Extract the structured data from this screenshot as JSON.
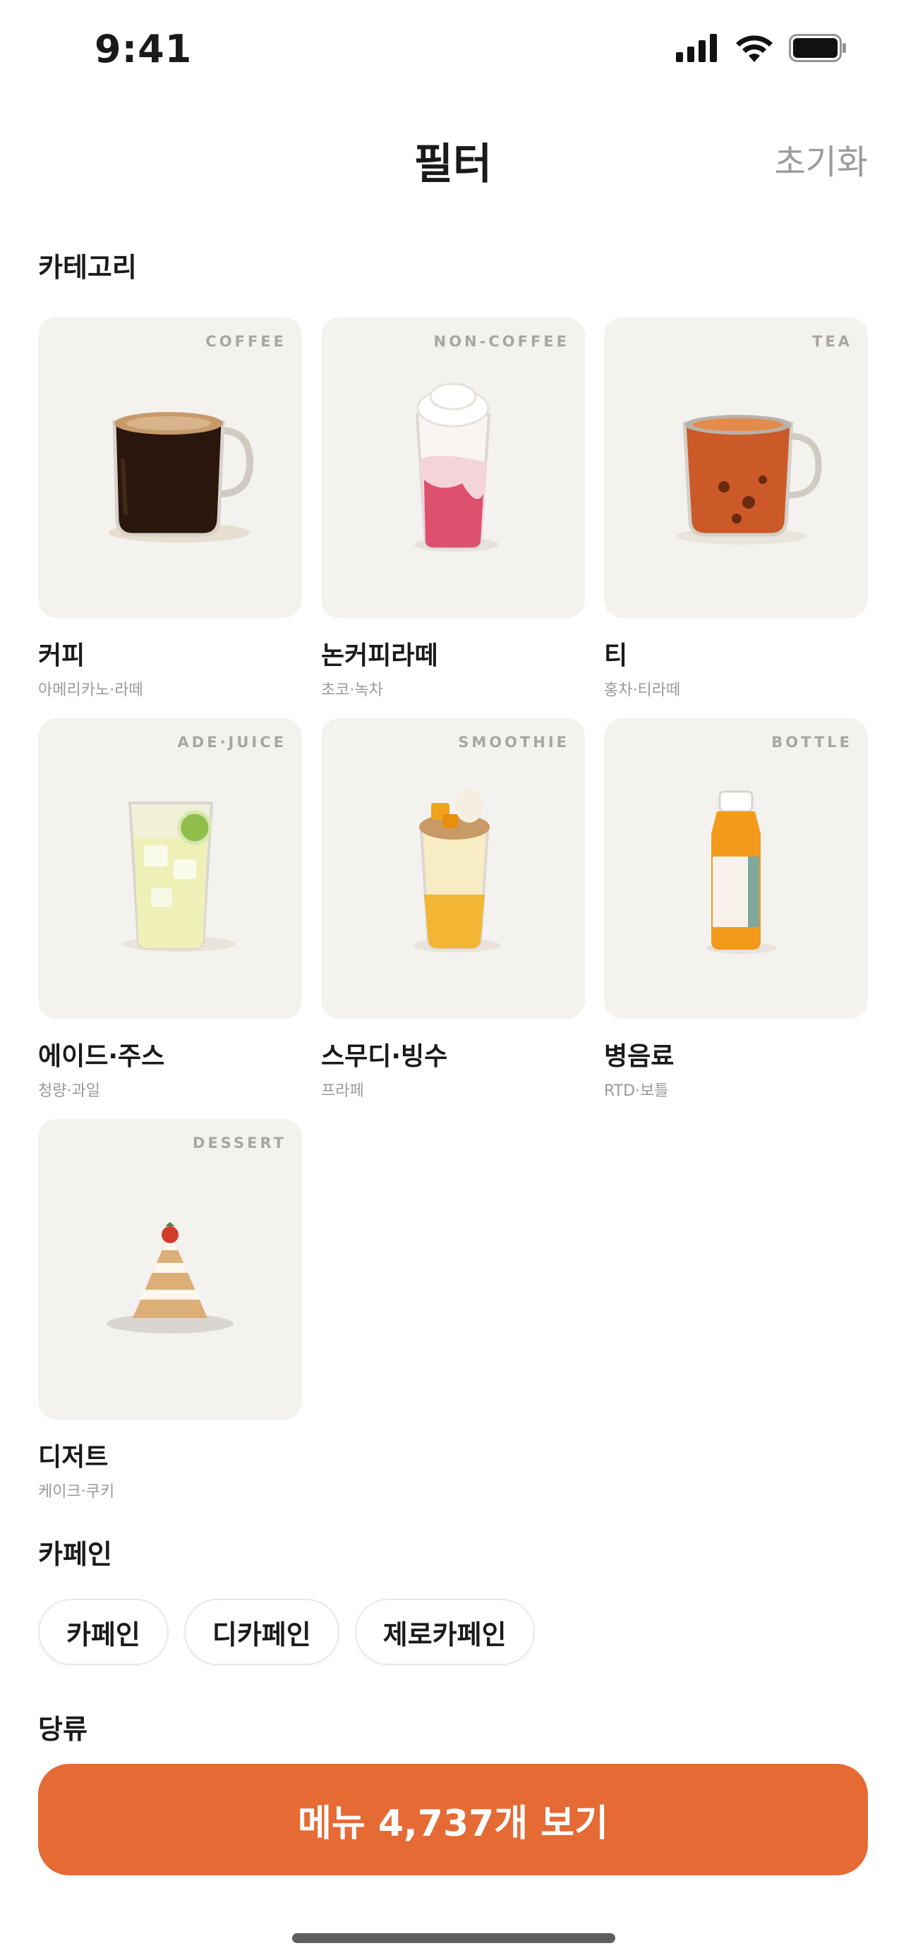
{
  "status": {
    "time": "9:41"
  },
  "header": {
    "title": "필터",
    "reset_label": "초기화"
  },
  "sections": {
    "category": "카테고리",
    "caffeine": "카페인",
    "sugar": "당류"
  },
  "categories": [
    {
      "tag": "COFFEE",
      "name": "커피",
      "sub": "아메리카노·라떼",
      "icon": "coffee-mug-icon"
    },
    {
      "tag": "NON-COFFEE",
      "name": "논커피라떼",
      "sub": "초코·녹차",
      "icon": "strawberry-latte-icon"
    },
    {
      "tag": "TEA",
      "name": "티",
      "sub": "홍차·티라떼",
      "icon": "tea-mug-icon"
    },
    {
      "tag": "ADE·JUICE",
      "name": "에이드·주스",
      "sub": "청량·과일",
      "icon": "ade-glass-icon"
    },
    {
      "tag": "SMOOTHIE",
      "name": "스무디·빙수",
      "sub": "프라페",
      "icon": "smoothie-icon"
    },
    {
      "tag": "BOTTLE",
      "name": "병음료",
      "sub": "RTD·보틀",
      "icon": "bottle-icon"
    },
    {
      "tag": "DESSERT",
      "name": "디저트",
      "sub": "케이크·쿠키",
      "icon": "cake-icon"
    }
  ],
  "caffeine_chips": [
    "카페인",
    "디카페인",
    "제로카페인"
  ],
  "cta": {
    "label": "메뉴 4,737개 보기"
  },
  "colors": {
    "accent": "#e56a34",
    "tile_bg": "#f4f2ef",
    "muted_text": "#9b9b9b"
  }
}
